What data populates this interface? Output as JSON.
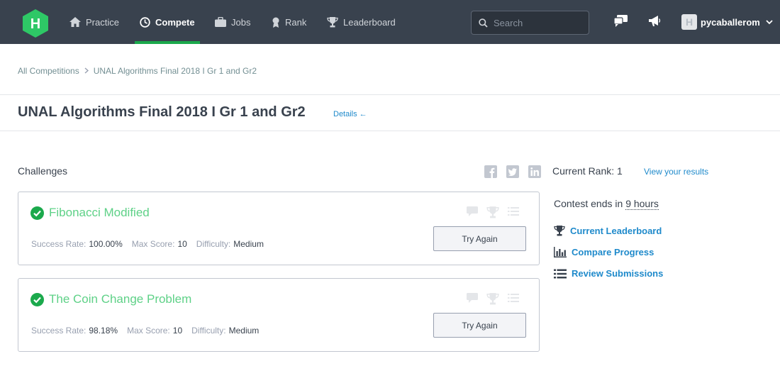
{
  "nav": {
    "logo": "H",
    "items": [
      {
        "label": "Practice",
        "icon": "home-icon"
      },
      {
        "label": "Compete",
        "icon": "clock-icon",
        "active": true
      },
      {
        "label": "Jobs",
        "icon": "briefcase-icon"
      },
      {
        "label": "Rank",
        "icon": "medal-icon"
      },
      {
        "label": "Leaderboard",
        "icon": "trophy-icon"
      }
    ],
    "search_placeholder": "Search",
    "username": "pycaballerom",
    "avatar_letter": "H"
  },
  "breadcrumb": {
    "root": "All Competitions",
    "current": "UNAL Algorithms Final 2018 I Gr 1 and Gr2"
  },
  "page": {
    "title": "UNAL Algorithms Final 2018 I Gr 1 and Gr2",
    "details_label": "Details ←"
  },
  "challenges": {
    "heading": "Challenges",
    "share_icons": [
      "facebook-icon",
      "twitter-icon",
      "linkedin-icon"
    ],
    "items": [
      {
        "title": "Fibonacci Modified",
        "success_label": "Success Rate:",
        "success_rate": "100.00%",
        "max_score_label": "Max Score:",
        "max_score": "10",
        "difficulty_label": "Difficulty:",
        "difficulty": "Medium",
        "button": "Try Again"
      },
      {
        "title": "The Coin Change Problem",
        "success_label": "Success Rate:",
        "success_rate": "98.18%",
        "max_score_label": "Max Score:",
        "max_score": "10",
        "difficulty_label": "Difficulty:",
        "difficulty": "Medium",
        "button": "Try Again"
      }
    ]
  },
  "sidebar": {
    "rank_label": "Current Rank: 1",
    "view_results": "View your results",
    "contest_ends_prefix": "Contest ends in",
    "contest_ends_time": "9 hours",
    "links": [
      {
        "label": "Current Leaderboard",
        "icon": "trophy-icon"
      },
      {
        "label": "Compare Progress",
        "icon": "bar-chart-icon"
      },
      {
        "label": "Review Submissions",
        "icon": "list-icon"
      }
    ]
  },
  "colors": {
    "nav_bg": "#39424e",
    "accent_green": "#1ba94c",
    "title_green": "#5ed187",
    "link_blue": "#1f8acb"
  }
}
